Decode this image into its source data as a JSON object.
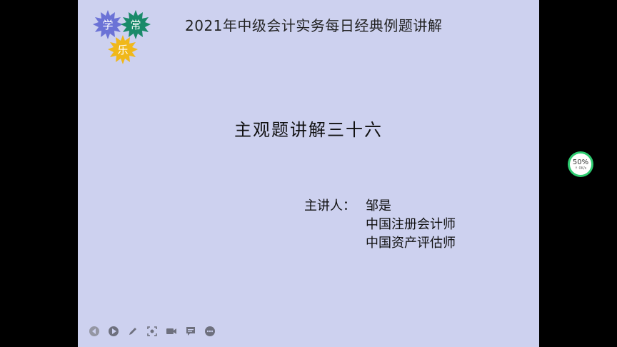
{
  "logo": {
    "chars": [
      "学",
      "常",
      "乐"
    ],
    "colors": [
      "#6b72d6",
      "#1a8a6a",
      "#f0b81a"
    ]
  },
  "header": {
    "title": "2021年中级会计实务每日经典例题讲解"
  },
  "slide": {
    "main_title": "主观题讲解三十六",
    "presenter_label": "主讲人：",
    "presenter_name": "邹是",
    "credentials": [
      "中国注册会计师",
      "中国资产评估师"
    ]
  },
  "toolbar": {
    "icons": [
      "back-icon",
      "play-icon",
      "pen-icon",
      "screenshot-icon",
      "camera-icon",
      "comment-icon",
      "more-icon"
    ]
  },
  "zoom": {
    "value": "50%",
    "speed": "↑ 0K/s"
  },
  "colors": {
    "slide_bg": "#cdd1ef",
    "zoom_ring": "#2ecc71"
  }
}
